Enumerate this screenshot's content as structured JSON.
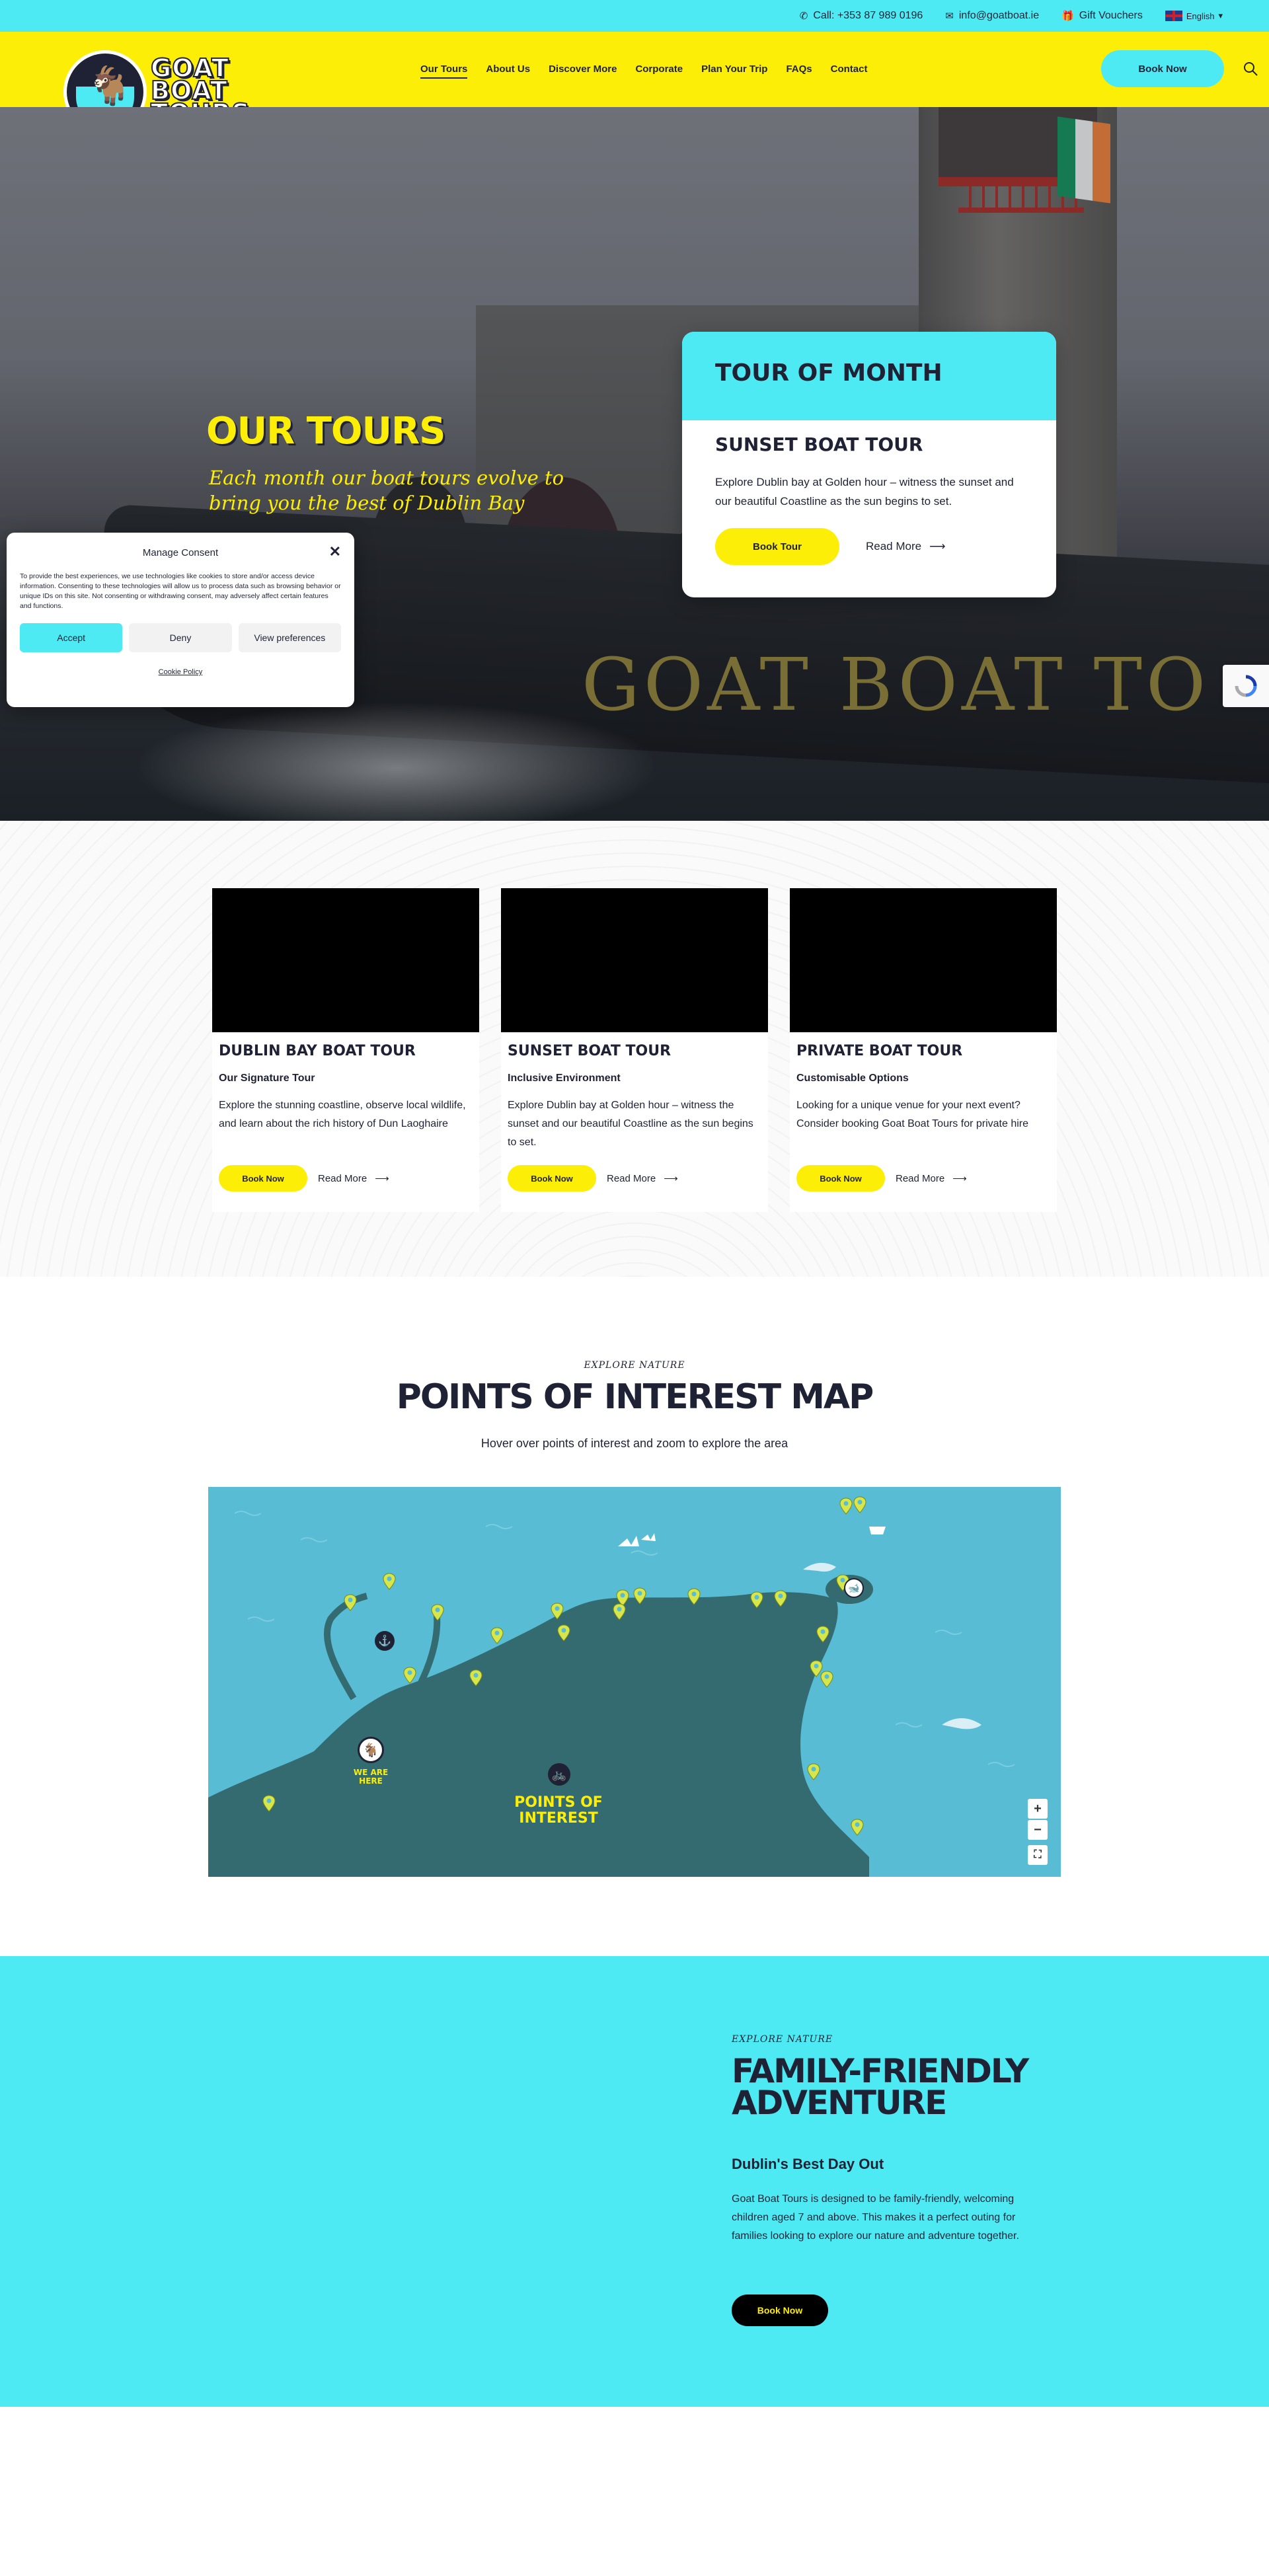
{
  "topbar": {
    "phone": "Call: +353 87 989 0196",
    "email": "info@goatboat.ie",
    "vouchers": "Gift Vouchers",
    "language": "English"
  },
  "header": {
    "logo_line1": "GOAT",
    "logo_line2": "BOAT",
    "logo_line3": "TOURS",
    "nav": [
      "Our Tours",
      "About Us",
      "Discover More",
      "Corporate",
      "Plan Your Trip",
      "FAQs",
      "Contact"
    ],
    "book_now": "Book Now"
  },
  "hero": {
    "title": "OUR TOURS",
    "subtitle": "Each month our boat tours evolve to bring you the best of Dublin Bay",
    "boat_lettering": "GOAT BOAT TO"
  },
  "tour_of_month": {
    "heading": "TOUR OF MONTH",
    "name": "SUNSET BOAT TOUR",
    "description": "Explore Dublin bay at Golden hour – witness the sunset and our beautiful Coastline as the sun begins to set.",
    "button": "Book Tour",
    "read_more": "Read More"
  },
  "cookie": {
    "title": "Manage Consent",
    "text": "To provide the best experiences, we use technologies like cookies to store and/or access device information. Consenting to these technologies will allow us to process data such as browsing behavior or unique IDs on this site. Not consenting or withdrawing consent, may adversely affect certain features and functions.",
    "accept": "Accept",
    "deny": "Deny",
    "preferences": "View preferences",
    "policy": "Cookie Policy"
  },
  "tours": [
    {
      "title": "DUBLIN BAY BOAT TOUR",
      "tag": "Our Signature Tour",
      "description": "Explore the stunning coastline, observe local wildlife, and learn about the rich history of Dun Laoghaire",
      "book": "Book Now",
      "read_more": "Read More"
    },
    {
      "title": "SUNSET BOAT TOUR",
      "tag": "Inclusive Environment",
      "description": "Explore Dublin bay at Golden hour – witness the sunset and our beautiful Coastline as the sun begins to set.",
      "book": "Book Now",
      "read_more": "Read More"
    },
    {
      "title": "PRIVATE BOAT TOUR",
      "tag": "Customisable Options",
      "description": "Looking for a unique venue for your next event? Consider booking Goat Boat Tours for private hire",
      "book": "Book Now",
      "read_more": "Read More"
    }
  ],
  "poi": {
    "kicker": "EXPLORE NATURE",
    "title": "POINTS OF INTEREST MAP",
    "subtitle": "Hover over points of interest and zoom to explore the area",
    "we_are_here_1": "WE ARE",
    "we_are_here_2": "HERE",
    "poi_label_1": "POINTS OF",
    "poi_label_2": "INTEREST",
    "zoom_in": "+",
    "zoom_out": "−"
  },
  "family": {
    "kicker": "EXPLORE NATURE",
    "title": "FAMILY-FRIENDLY ADVENTURE",
    "subtitle": "Dublin's Best Day Out",
    "description": "Goat Boat Tours is designed to be family-friendly, welcoming children aged 7 and above. This makes it a perfect outing for families looking to explore our nature and adventure together.",
    "button": "Book Now"
  },
  "colors": {
    "cyan": "#4deaf3",
    "yellow": "#fdee07",
    "navy": "#1f2235"
  }
}
